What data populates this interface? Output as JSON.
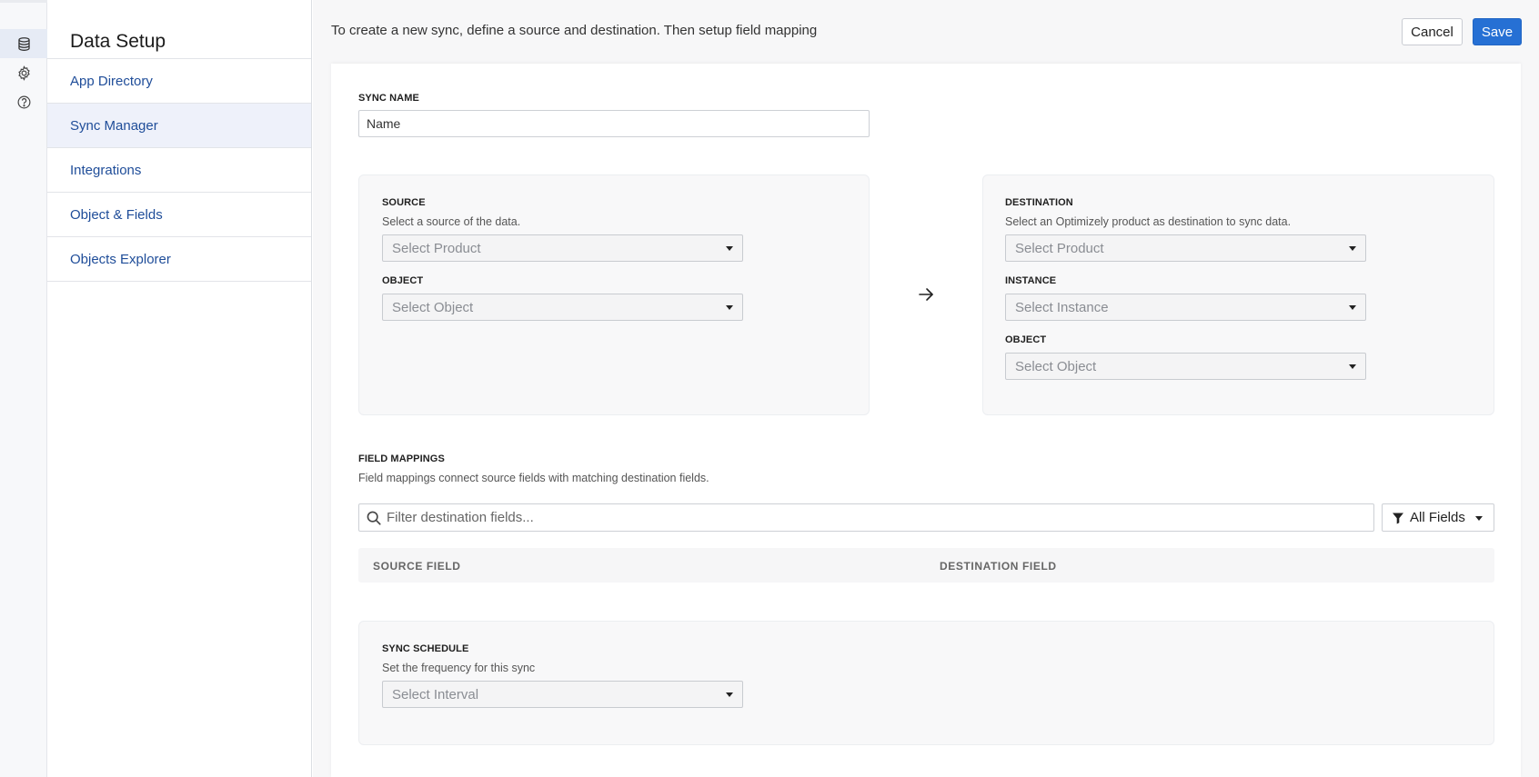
{
  "rail": {
    "icons": [
      "database-icon",
      "gear-icon",
      "help-circle-icon"
    ]
  },
  "nav": {
    "title": "Data Setup",
    "items": [
      {
        "label": "App Directory"
      },
      {
        "label": "Sync Manager"
      },
      {
        "label": "Integrations"
      },
      {
        "label": "Object & Fields"
      },
      {
        "label": "Objects Explorer"
      }
    ],
    "active_item": "Sync Manager"
  },
  "header": {
    "instructions": "To create a new sync, define a source and destination. Then setup field mapping",
    "cancel_label": "Cancel",
    "save_label": "Save"
  },
  "sync_name": {
    "label": "SYNC NAME",
    "placeholder": "Name"
  },
  "source": {
    "label": "SOURCE",
    "description": "Select a source of the data.",
    "product_placeholder": "Select Product",
    "object_label": "OBJECT",
    "object_placeholder": "Select Object"
  },
  "destination": {
    "label": "DESTINATION",
    "description": "Select an Optimizely product as destination to sync data.",
    "product_placeholder": "Select Product",
    "instance_label": "INSTANCE",
    "instance_placeholder": "Select Instance",
    "object_label": "OBJECT",
    "object_placeholder": "Select Object"
  },
  "field_mappings": {
    "label": "FIELD MAPPINGS",
    "description": "Field mappings connect source fields with matching destination fields.",
    "filter_placeholder": "Filter destination fields...",
    "filter_dropdown": "All Fields",
    "columns": [
      "SOURCE FIELD",
      "DESTINATION FIELD"
    ]
  },
  "sync_schedule": {
    "label": "SYNC SCHEDULE",
    "description": "Set the frequency for this sync",
    "interval_placeholder": "Select Interval"
  },
  "colors": {
    "accent": "#2670d4",
    "nav_link": "#1f4d99",
    "active_nav_bg": "#eef1fa"
  }
}
